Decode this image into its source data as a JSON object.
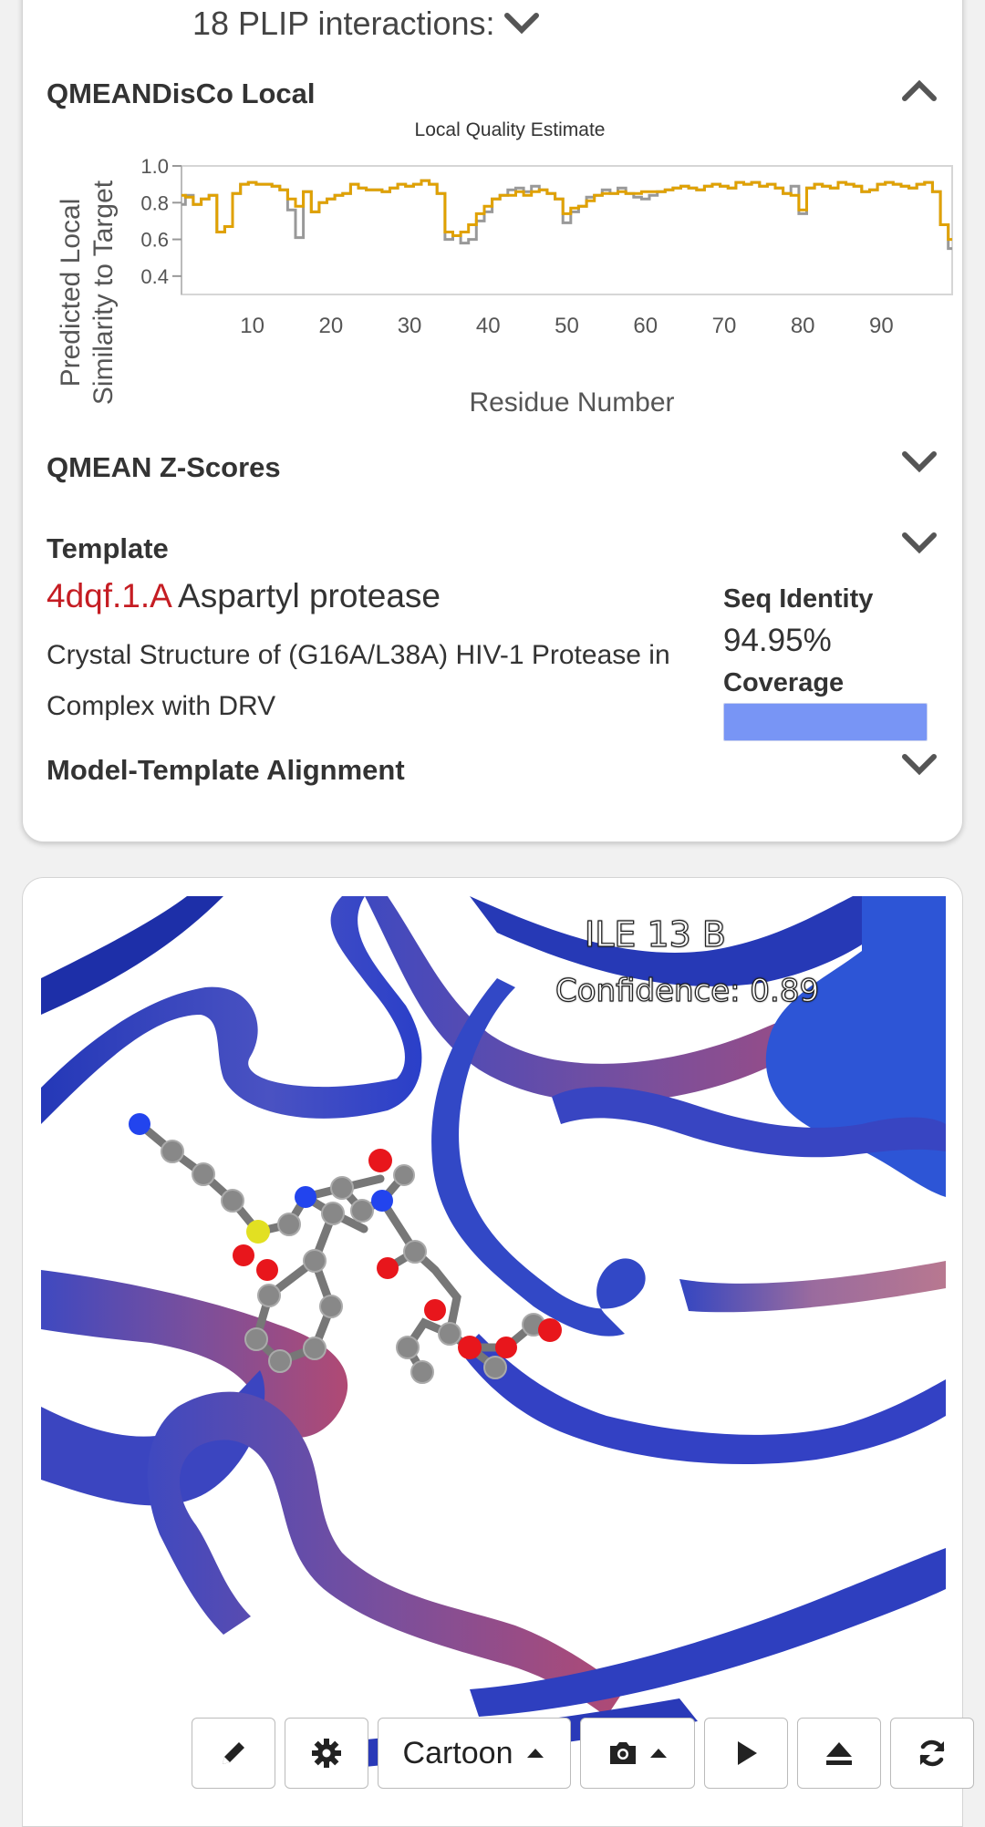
{
  "plip": {
    "label": "18 PLIP interactions:"
  },
  "sections": {
    "local": "QMEANDisCo Local",
    "zscores": "QMEAN Z-Scores",
    "template": "Template",
    "alignment": "Model-Template Alignment"
  },
  "chart_data": {
    "type": "line",
    "title": "Local Quality Estimate",
    "xlabel": "Residue Number",
    "ylabel": "Predicted Local Similarity to Target",
    "ylabel_lines": [
      "Predicted Local",
      "Similarity to Target"
    ],
    "xlim": [
      1,
      99
    ],
    "ylim": [
      0.3,
      1.0
    ],
    "x_ticks": [
      10,
      20,
      30,
      40,
      50,
      60,
      70,
      80,
      90
    ],
    "y_ticks": [
      0.4,
      0.6,
      0.8,
      1.0
    ],
    "y_tick_labels": [
      "0.4",
      "0.6",
      "0.8",
      "1.0"
    ],
    "series": [
      {
        "color": "#999999",
        "values": [
          0.79,
          0.84,
          0.79,
          0.82,
          0.84,
          0.64,
          0.67,
          0.85,
          0.9,
          0.91,
          0.9,
          0.9,
          0.89,
          0.87,
          0.76,
          0.61,
          0.86,
          0.75,
          0.8,
          0.82,
          0.84,
          0.85,
          0.9,
          0.88,
          0.87,
          0.87,
          0.86,
          0.88,
          0.9,
          0.89,
          0.9,
          0.92,
          0.9,
          0.85,
          0.6,
          0.62,
          0.58,
          0.6,
          0.7,
          0.75,
          0.82,
          0.84,
          0.87,
          0.88,
          0.86,
          0.89,
          0.87,
          0.85,
          0.82,
          0.69,
          0.75,
          0.78,
          0.83,
          0.84,
          0.87,
          0.85,
          0.88,
          0.85,
          0.83,
          0.82,
          0.84,
          0.86,
          0.87,
          0.88,
          0.89,
          0.88,
          0.87,
          0.89,
          0.9,
          0.89,
          0.88,
          0.91,
          0.9,
          0.91,
          0.89,
          0.9,
          0.88,
          0.85,
          0.89,
          0.74,
          0.88,
          0.9,
          0.89,
          0.88,
          0.91,
          0.9,
          0.89,
          0.86,
          0.87,
          0.9,
          0.91,
          0.9,
          0.89,
          0.88,
          0.9,
          0.91,
          0.86,
          0.68,
          0.55
        ]
      },
      {
        "color": "#e0a100",
        "values": [
          0.84,
          0.83,
          0.79,
          0.82,
          0.84,
          0.64,
          0.67,
          0.85,
          0.9,
          0.91,
          0.9,
          0.9,
          0.89,
          0.87,
          0.82,
          0.78,
          0.86,
          0.75,
          0.8,
          0.82,
          0.84,
          0.85,
          0.9,
          0.88,
          0.87,
          0.87,
          0.86,
          0.88,
          0.9,
          0.89,
          0.9,
          0.92,
          0.9,
          0.85,
          0.64,
          0.62,
          0.64,
          0.68,
          0.74,
          0.78,
          0.82,
          0.84,
          0.84,
          0.86,
          0.84,
          0.86,
          0.87,
          0.85,
          0.82,
          0.74,
          0.77,
          0.78,
          0.81,
          0.84,
          0.85,
          0.85,
          0.86,
          0.85,
          0.85,
          0.86,
          0.86,
          0.86,
          0.87,
          0.88,
          0.89,
          0.88,
          0.87,
          0.89,
          0.9,
          0.89,
          0.88,
          0.91,
          0.9,
          0.91,
          0.89,
          0.9,
          0.88,
          0.85,
          0.84,
          0.76,
          0.88,
          0.9,
          0.89,
          0.88,
          0.91,
          0.9,
          0.89,
          0.86,
          0.87,
          0.9,
          0.91,
          0.9,
          0.89,
          0.88,
          0.9,
          0.91,
          0.86,
          0.68,
          0.6
        ]
      }
    ],
    "grid": false,
    "legend": "none"
  },
  "template": {
    "id": "4dqf.1.A",
    "name": "Aspartyl protease",
    "description": "Crystal Structure of (G16A/L38A) HIV-1 Protease in Complex with DRV",
    "seq_identity_label": "Seq Identity",
    "seq_identity_value": "94.95%",
    "coverage_label": "Coverage",
    "coverage_fraction": 1.0
  },
  "viewer": {
    "residue_label": "ILE 13 B",
    "confidence_label": "Confidence: 0.89"
  },
  "toolbar": {
    "style_label": "Cartoon",
    "buttons": [
      "pencil-icon",
      "gear-icon",
      "camera-icon",
      "play-icon",
      "eject-icon",
      "refresh-icon"
    ]
  },
  "colors": {
    "template_id": "#c51d23",
    "coverage": "#7895f5",
    "ribbon": "#3a4fc4",
    "oxygen": "#e8161c",
    "nitrogen": "#2244ee",
    "sulfur": "#e2e022",
    "carbon": "#888888"
  }
}
